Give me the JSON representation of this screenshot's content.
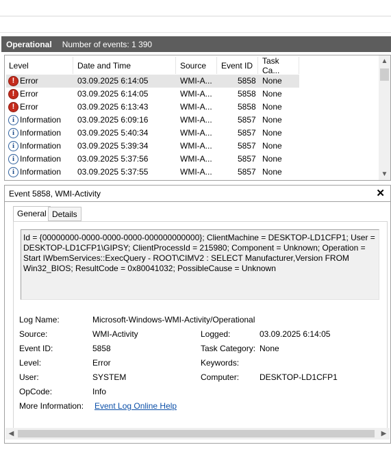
{
  "pane": {
    "title": "Operational",
    "count_text": "Number of events: 1 390"
  },
  "columns": [
    "Level",
    "Date and Time",
    "Source",
    "Event ID",
    "Task Ca..."
  ],
  "events": [
    {
      "level": "Error",
      "icon": "error-icon",
      "date": "03.09.2025 6:14:05",
      "source": "WMI-A...",
      "id": "5858",
      "task": "None",
      "selected": true
    },
    {
      "level": "Error",
      "icon": "error-icon",
      "date": "03.09.2025 6:14:05",
      "source": "WMI-A...",
      "id": "5858",
      "task": "None"
    },
    {
      "level": "Error",
      "icon": "error-icon",
      "date": "03.09.2025 6:13:43",
      "source": "WMI-A...",
      "id": "5858",
      "task": "None"
    },
    {
      "level": "Information",
      "icon": "info-icon",
      "date": "03.09.2025 6:09:16",
      "source": "WMI-A...",
      "id": "5857",
      "task": "None"
    },
    {
      "level": "Information",
      "icon": "info-icon",
      "date": "03.09.2025 5:40:34",
      "source": "WMI-A...",
      "id": "5857",
      "task": "None"
    },
    {
      "level": "Information",
      "icon": "info-icon",
      "date": "03.09.2025 5:39:34",
      "source": "WMI-A...",
      "id": "5857",
      "task": "None"
    },
    {
      "level": "Information",
      "icon": "info-icon",
      "date": "03.09.2025 5:37:56",
      "source": "WMI-A...",
      "id": "5857",
      "task": "None"
    },
    {
      "level": "Information",
      "icon": "info-icon",
      "date": "03.09.2025 5:37:55",
      "source": "WMI-A...",
      "id": "5857",
      "task": "None"
    }
  ],
  "detail": {
    "title": "Event 5858, WMI-Activity",
    "tabs": [
      "General",
      "Details"
    ],
    "description": "Id = {00000000-0000-0000-0000-000000000000}; ClientMachine = DESKTOP-LD1CFP1; User = DESKTOP-LD1CFP1\\GIPSY; ClientProcessId = 215980; Component = Unknown; Operation = Start IWbemServices::ExecQuery - ROOT\\CIMV2 : SELECT Manufacturer,Version FROM Win32_BIOS; ResultCode = 0x80041032; PossibleCause = Unknown",
    "labels": {
      "log_name": "Log Name:",
      "source": "Source:",
      "event_id": "Event ID:",
      "level": "Level:",
      "user": "User:",
      "opcode": "OpCode:",
      "more_info": "More Information:",
      "logged": "Logged:",
      "task_category": "Task Category:",
      "keywords": "Keywords:",
      "computer": "Computer:"
    },
    "values": {
      "log_name": "Microsoft-Windows-WMI-Activity/Operational",
      "source": "WMI-Activity",
      "event_id": "5858",
      "level": "Error",
      "user": "SYSTEM",
      "opcode": "Info",
      "more_info": "Event Log Online Help",
      "logged": "03.09.2025 6:14:05",
      "task_category": "None",
      "keywords": "",
      "computer": "DESKTOP-LD1CFP1"
    }
  }
}
